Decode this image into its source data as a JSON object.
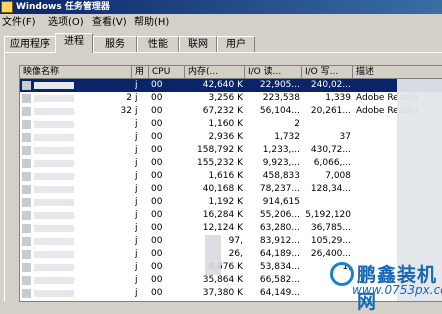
{
  "window": {
    "title": "Windows 任务管理器"
  },
  "menu": [
    {
      "label": "文件(F)"
    },
    {
      "label": "选项(O)"
    },
    {
      "label": "查看(V)"
    },
    {
      "label": "帮助(H)"
    }
  ],
  "tabs": [
    {
      "label": "应用程序"
    },
    {
      "label": "进程"
    },
    {
      "label": "服务"
    },
    {
      "label": "性能"
    },
    {
      "label": "联网"
    },
    {
      "label": "用户"
    }
  ],
  "selected_tab": "进程",
  "table": {
    "columns": [
      "映像名称",
      "用",
      "CPU",
      "内存(...",
      "I/O 读...",
      "I/O 写...",
      "描述"
    ],
    "rows": [
      {
        "name": "",
        "user": "j",
        "cpu": "00",
        "mem": "42,640 K",
        "io_read": "22,905...",
        "io_write": "240,02...",
        "desc": "",
        "selected": true
      },
      {
        "name": "2",
        "user": "j",
        "cpu": "00",
        "mem": "3,256 K",
        "io_read": "223,538",
        "io_write": "1,339",
        "desc": "Adobe Reader"
      },
      {
        "name": "32",
        "user": "j",
        "cpu": "00",
        "mem": "67,232 K",
        "io_read": "56,104...",
        "io_write": "20,261...",
        "desc": "Adobe Reader"
      },
      {
        "name": "",
        "user": "j",
        "cpu": "00",
        "mem": "1,160 K",
        "io_read": "2",
        "io_write": "",
        "desc": ""
      },
      {
        "name": "",
        "user": "j",
        "cpu": "00",
        "mem": "2,936 K",
        "io_read": "1,732",
        "io_write": "37",
        "desc": ""
      },
      {
        "name": "",
        "user": "j",
        "cpu": "00",
        "mem": "158,792 K",
        "io_read": "1,233,...",
        "io_write": "430,72...",
        "desc": ""
      },
      {
        "name": "",
        "user": "j",
        "cpu": "00",
        "mem": "155,232 K",
        "io_read": "9,923,...",
        "io_write": "6,066,...",
        "desc": ""
      },
      {
        "name": "",
        "user": "j",
        "cpu": "00",
        "mem": "1,616 K",
        "io_read": "458,833",
        "io_write": "7,008",
        "desc": ""
      },
      {
        "name": "",
        "user": "j",
        "cpu": "00",
        "mem": "40,168 K",
        "io_read": "78,237...",
        "io_write": "128,34...",
        "desc": ""
      },
      {
        "name": "",
        "user": "j",
        "cpu": "00",
        "mem": "1,192 K",
        "io_read": "914,615",
        "io_write": "",
        "desc": ""
      },
      {
        "name": "",
        "user": "j",
        "cpu": "00",
        "mem": "16,284 K",
        "io_read": "55,206...",
        "io_write": "5,192,120",
        "desc": ""
      },
      {
        "name": "",
        "user": "j",
        "cpu": "00",
        "mem": "12,124 K",
        "io_read": "63,280...",
        "io_write": "36,785...",
        "desc": ""
      },
      {
        "name": "",
        "user": "j",
        "cpu": "00",
        "mem": "97,",
        "io_read": "83,912...",
        "io_write": "105,29...",
        "desc": ""
      },
      {
        "name": "",
        "user": "j",
        "cpu": "00",
        "mem": "26,",
        "io_read": "64,189...",
        "io_write": "26,400...",
        "desc": ""
      },
      {
        "name": "",
        "user": "j",
        "cpu": "00",
        "mem": "8,676 K",
        "io_read": "53,834...",
        "io_write": "1,",
        "desc": ""
      },
      {
        "name": "",
        "user": "j",
        "cpu": "00",
        "mem": "35,864 K",
        "io_read": "66,582...",
        "io_write": "",
        "desc": ""
      },
      {
        "name": "",
        "user": "j",
        "cpu": "00",
        "mem": "37,380 K",
        "io_read": "64,149...",
        "io_write": "",
        "desc": ""
      }
    ]
  },
  "watermark": {
    "text": "鹏鑫装机网",
    "url": "www.0753px.com"
  }
}
